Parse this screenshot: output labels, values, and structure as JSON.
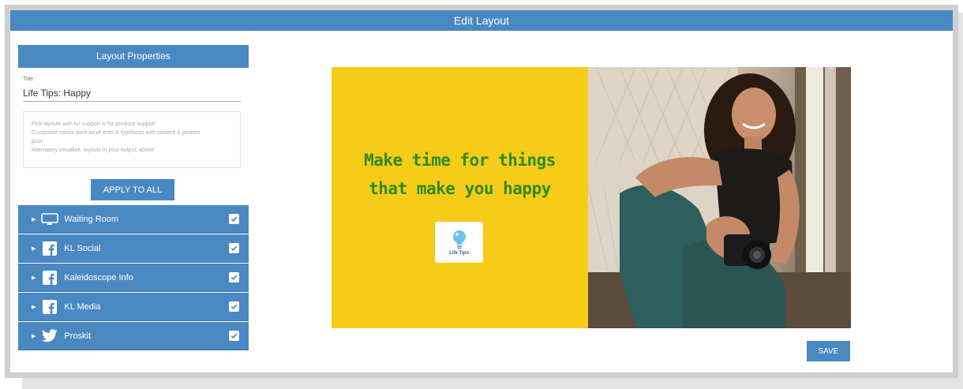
{
  "window": {
    "title": "Edit Layout"
  },
  "layout_properties": {
    "header": "Layout Properties",
    "title_label": "Title",
    "title_value": "Life Tips: Happy",
    "description_lines": [
      "Pick layouts with for support is for produce support.",
      "Customize colors such as of texts & typefaces with content & posters",
      "post.",
      "Alternately visualize, layouts in your output, above"
    ],
    "apply_button": "APPLY TO ALL"
  },
  "accounts": [
    {
      "label": "Waiting Room",
      "icon": "tv-icon",
      "checked": true
    },
    {
      "label": "KL Social",
      "icon": "facebook-icon",
      "checked": true
    },
    {
      "label": "Kaleidoscope Info",
      "icon": "facebook-icon",
      "checked": true
    },
    {
      "label": "KL Media",
      "icon": "facebook-icon",
      "checked": true
    },
    {
      "label": "Proskit",
      "icon": "twitter-icon",
      "checked": true
    }
  ],
  "preview": {
    "headline_line1": "Make time for things",
    "headline_line2": "that make you happy",
    "logo_text": "Life Tips",
    "background_color": "#f5cc18",
    "text_color": "#2f8a24"
  },
  "save_button": "SAVE",
  "colors": {
    "accent": "#4a88c2"
  }
}
